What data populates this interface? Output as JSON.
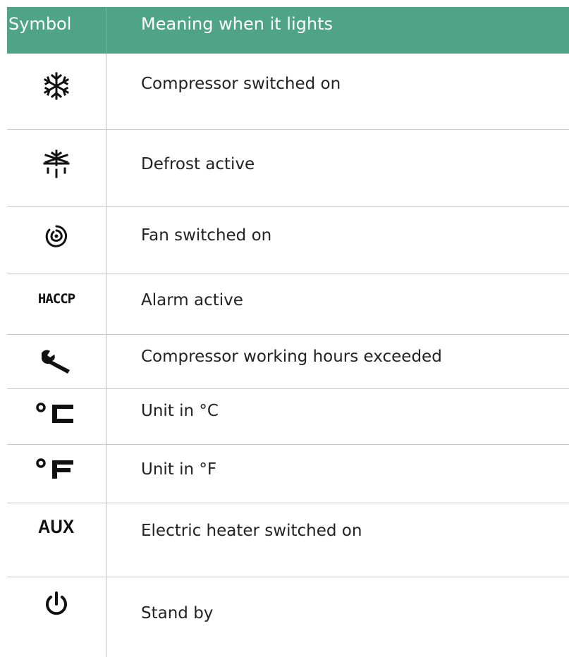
{
  "table": {
    "headers": {
      "symbol": "Symbol",
      "meaning": "Meaning when it lights"
    },
    "rows": [
      {
        "icon": "snowflake-icon",
        "meaning": "Compressor switched on"
      },
      {
        "icon": "defrost-icon",
        "meaning": "Defrost active"
      },
      {
        "icon": "fan-icon",
        "meaning": "Fan switched on"
      },
      {
        "icon": "haccp-icon",
        "label": "HACCP",
        "meaning": "Alarm active"
      },
      {
        "icon": "wrench-icon",
        "meaning": "Compressor working hours exceeded"
      },
      {
        "icon": "celsius-icon",
        "meaning": "Unit in °C"
      },
      {
        "icon": "fahrenheit-icon",
        "meaning": "Unit in °F"
      },
      {
        "icon": "aux-icon",
        "label": "AUX",
        "meaning": "Electric heater switched on"
      },
      {
        "icon": "power-icon",
        "meaning": "Stand by"
      }
    ],
    "colors": {
      "header_bg": "#4fa387",
      "header_text": "#ffffff",
      "grid": "#c9c9c9"
    }
  }
}
